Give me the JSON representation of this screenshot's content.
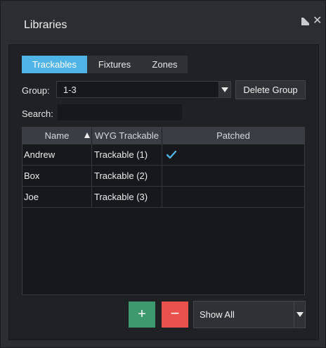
{
  "window": {
    "title": "Libraries"
  },
  "tabs": [
    {
      "label": "Trackables",
      "active": true
    },
    {
      "label": "Fixtures",
      "active": false
    },
    {
      "label": "Zones",
      "active": false
    }
  ],
  "group": {
    "label": "Group:",
    "value": "1-3",
    "delete_label": "Delete Group"
  },
  "search": {
    "label": "Search:",
    "value": ""
  },
  "table": {
    "columns": [
      "Name",
      "WYG Trackable",
      "Patched"
    ],
    "sort_column": "Name",
    "sort_direction": "ascending",
    "rows": [
      {
        "name": "Andrew",
        "wyg": "Trackable (1)",
        "patched": true
      },
      {
        "name": "Box",
        "wyg": "Trackable (2)",
        "patched": false
      },
      {
        "name": "Joe",
        "wyg": "Trackable (3)",
        "patched": false
      }
    ]
  },
  "footer": {
    "add_label": "+",
    "remove_label": "−",
    "filter_value": "Show All"
  },
  "colors": {
    "accent": "#4fb3e6",
    "add": "#3d9a6e",
    "remove": "#e9514d"
  },
  "icons": {
    "popout": "popout-icon",
    "close": "close-icon",
    "check": "check-icon",
    "sort": "sort-ascending-icon"
  }
}
